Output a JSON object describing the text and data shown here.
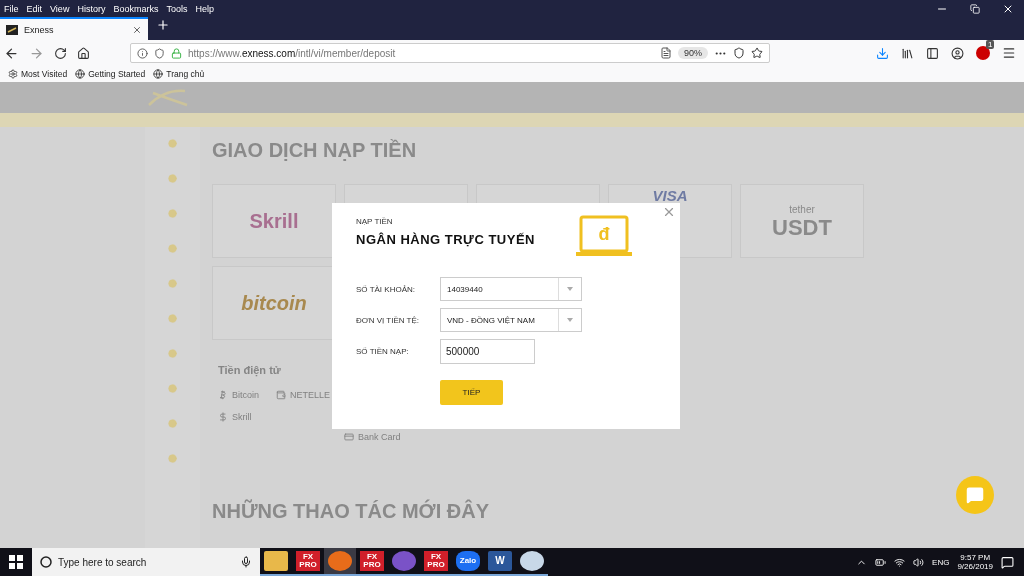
{
  "browser": {
    "menu": [
      "File",
      "Edit",
      "View",
      "History",
      "Bookmarks",
      "Tools",
      "Help"
    ],
    "tabs": [
      {
        "title": "Exness",
        "selected": true
      }
    ],
    "url": "https://www.**exness.com**/intl/vi/member/deposit",
    "zoom": "90%",
    "addon_badge": "1",
    "bookmarks": [
      {
        "kind": "gear",
        "label": "Most Visited"
      },
      {
        "kind": "globe",
        "label": "Getting Started"
      },
      {
        "kind": "globe",
        "label": "Trang chủ"
      }
    ]
  },
  "page": {
    "title": "GIAO DỊCH NẠP TIỀN",
    "methods": [
      {
        "kind": "skrill",
        "label": "Skrill"
      },
      {
        "kind": "blank"
      },
      {
        "kind": "blank"
      },
      {
        "kind": "visa",
        "label": "VISA"
      },
      {
        "kind": "tether",
        "label": "USDT",
        "sub": "tether"
      },
      {
        "kind": "bitcoin",
        "label": "bitcoin"
      }
    ],
    "section": "Tiền điện tử",
    "links": [
      {
        "kind": "coin",
        "label": "Bitcoin"
      },
      {
        "kind": "wallet",
        "label": "NETELLE"
      },
      {
        "kind": "dollar",
        "label": "Skrill"
      }
    ],
    "other_links": [
      {
        "kind": "card",
        "label": "Bank Card"
      }
    ],
    "recent_title": "NHỮNG THAO TÁC MỚI ĐÂY"
  },
  "modal": {
    "eyebrow": "NẠP TIỀN",
    "title": "NGÂN HÀNG TRỰC TUYẾN",
    "icon_glyph": "đ",
    "fields": [
      {
        "kind": "select",
        "label": "SỐ TÀI KHOẢN:",
        "value": "14039440"
      },
      {
        "kind": "select",
        "label": "ĐƠN VỊ TIỀN TỆ:",
        "value": "VND - ĐỒNG VIỆT NAM"
      },
      {
        "kind": "input",
        "label": "SỐ TIỀN NẠP:",
        "value": "500000"
      }
    ],
    "submit": "TIẾP"
  },
  "taskbar": {
    "search_placeholder": "Type here to search",
    "apps": [
      {
        "kind": "explorer",
        "selected": false
      },
      {
        "kind": "fxpro",
        "label": "FX PRO",
        "selected": false
      },
      {
        "kind": "firefox",
        "selected": true
      },
      {
        "kind": "fxpro",
        "label": "FX PRO",
        "selected": false
      },
      {
        "kind": "viber",
        "selected": false
      },
      {
        "kind": "fxpro",
        "label": "FX PRO",
        "selected": false
      },
      {
        "kind": "zalo",
        "label": "Zalo",
        "selected": false
      },
      {
        "kind": "word",
        "label": "W",
        "selected": false
      },
      {
        "kind": "paint",
        "selected": false
      }
    ],
    "language": "ENG",
    "time": "9:57 PM",
    "date": "9/26/2019"
  }
}
